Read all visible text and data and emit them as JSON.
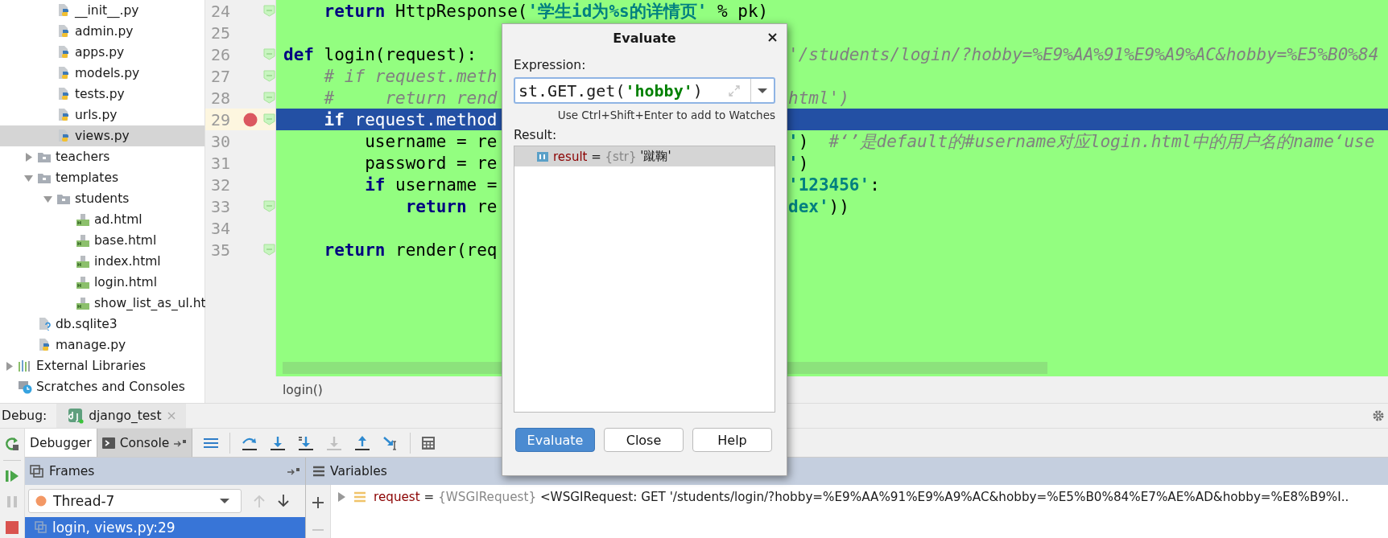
{
  "tree": [
    {
      "children": [
        {
          "children": [
            {
              "label": "__init__.py",
              "kind": "python",
              "selected": false
            },
            {
              "label": "admin.py",
              "kind": "python",
              "selected": false
            },
            {
              "label": "apps.py",
              "kind": "python",
              "selected": false
            },
            {
              "label": "models.py",
              "kind": "python",
              "selected": false
            },
            {
              "label": "tests.py",
              "kind": "python",
              "selected": false
            },
            {
              "label": "urls.py",
              "kind": "python",
              "selected": false
            },
            {
              "label": "views.py",
              "kind": "python",
              "selected": true
            }
          ]
        },
        {
          "label": "teachers",
          "kind": "folder",
          "expanded": false,
          "selected": false
        },
        {
          "label": "templates",
          "kind": "folder",
          "expanded": true,
          "selected": false,
          "children": [
            {
              "label": "students",
              "kind": "folder",
              "expanded": true,
              "selected": false,
              "children": [
                {
                  "label": "ad.html",
                  "kind": "html",
                  "selected": false
                },
                {
                  "label": "base.html",
                  "kind": "html",
                  "selected": false
                },
                {
                  "label": "index.html",
                  "kind": "html",
                  "selected": false
                },
                {
                  "label": "login.html",
                  "kind": "html",
                  "selected": false
                },
                {
                  "label": "show_list_as_ul.ht",
                  "kind": "html",
                  "selected": false
                }
              ]
            }
          ]
        },
        {
          "label": "db.sqlite3",
          "kind": "unknown",
          "selected": false
        },
        {
          "label": "manage.py",
          "kind": "python",
          "selected": false
        }
      ]
    },
    {
      "label": "External Libraries",
      "kind": "libraries",
      "expanded": false,
      "selected": false
    },
    {
      "label": "Scratches and Consoles",
      "kind": "scratches",
      "selected": false
    }
  ],
  "editor": {
    "lines": [
      {
        "number": "24",
        "breakpoint": false,
        "current": false,
        "fold": true,
        "left": [
          {
            "text": "    return",
            "kind": "keyword"
          },
          {
            "text": " HttpResponse(",
            "kind": "plain"
          },
          {
            "text": "'学生id为%s的详情页'",
            "kind": "string"
          },
          {
            "text": " % pk)",
            "kind": "plain"
          }
        ]
      },
      {
        "number": "25",
        "breakpoint": false,
        "current": false,
        "fold": false
      },
      {
        "number": "26",
        "breakpoint": false,
        "current": false,
        "fold": true,
        "left": [
          {
            "text": "def",
            "kind": "keyword"
          },
          {
            "text": " login(request):",
            "kind": "plain"
          }
        ],
        "right": [
          {
            "text": "'/students/login/?hobby=%E9%AA%91%E9%A9%AC&hobby=%E5%B0%84",
            "kind": "comment"
          }
        ]
      },
      {
        "number": "27",
        "breakpoint": false,
        "current": false,
        "fold": true,
        "left": [
          {
            "text": "    # if request.meth",
            "kind": "comment"
          }
        ]
      },
      {
        "number": "28",
        "breakpoint": false,
        "current": false,
        "fold": true,
        "left": [
          {
            "text": "    #     return rend",
            "kind": "comment"
          }
        ],
        "right": [
          {
            "text": "html')",
            "kind": "comment"
          }
        ]
      },
      {
        "number": "29",
        "breakpoint": true,
        "current": true,
        "fold": true,
        "left": [
          {
            "text": "    if",
            "kind": "keyword"
          },
          {
            "text": " request.method",
            "kind": "plain"
          }
        ]
      },
      {
        "number": "30",
        "breakpoint": false,
        "current": false,
        "fold": false,
        "left": [
          {
            "text": "        username = re",
            "kind": "plain"
          }
        ],
        "right": [
          {
            "text": "'",
            "kind": "string"
          },
          {
            "text": ")  ",
            "kind": "plain"
          },
          {
            "text": "#‘’是default的#username对应login.html中的用户名的name‘use",
            "kind": "comment"
          }
        ]
      },
      {
        "number": "31",
        "breakpoint": false,
        "current": false,
        "fold": false,
        "left": [
          {
            "text": "        password = re",
            "kind": "plain"
          }
        ],
        "right": [
          {
            "text": "'",
            "kind": "string"
          },
          {
            "text": ")",
            "kind": "plain"
          }
        ]
      },
      {
        "number": "32",
        "breakpoint": false,
        "current": false,
        "fold": false,
        "left": [
          {
            "text": "        if",
            "kind": "keyword"
          },
          {
            "text": " username =",
            "kind": "plain"
          }
        ],
        "right": [
          {
            "text": "'123456'",
            "kind": "string"
          },
          {
            "text": ":",
            "kind": "plain"
          }
        ]
      },
      {
        "number": "33",
        "breakpoint": false,
        "current": false,
        "fold": true,
        "left": [
          {
            "text": "            return",
            "kind": "keyword"
          },
          {
            "text": " re",
            "kind": "plain"
          }
        ],
        "right": [
          {
            "text": "dex'",
            "kind": "string"
          },
          {
            "text": "))",
            "kind": "plain"
          }
        ]
      },
      {
        "number": "34",
        "breakpoint": false,
        "current": false,
        "fold": false
      },
      {
        "number": "35",
        "breakpoint": false,
        "current": false,
        "fold": true,
        "left": [
          {
            "text": "    return",
            "kind": "keyword"
          },
          {
            "text": " render(req",
            "kind": "plain"
          }
        ]
      }
    ],
    "breadcrumb": "login()"
  },
  "debug": {
    "label": "Debug:",
    "session": "django_test",
    "tabs": [
      {
        "label": "Debugger",
        "selected": true
      },
      {
        "label": "Console",
        "selected": false
      }
    ],
    "toolbar": [
      {
        "kind": "step_over",
        "disabled": false
      },
      {
        "kind": "step_into",
        "disabled": false
      },
      {
        "kind": "step_into_my_code",
        "disabled": false
      },
      {
        "kind": "force_step_into",
        "disabled": true
      },
      {
        "kind": "step_out",
        "disabled": false
      },
      {
        "kind": "run_to_cursor",
        "disabled": false
      }
    ],
    "frames": {
      "title": "Frames",
      "thread": "Thread-7",
      "items": [
        {
          "label": "login, views.py:29",
          "selected": true
        }
      ]
    },
    "variables": {
      "title": "Variables",
      "items": [
        {
          "name": "request",
          "equals": "=",
          "type": "{WSGIRequest}",
          "value": "<WSGIRequest: GET '/students/login/?hobby=%E9%AA%91%E9%A9%AC&hobby=%E5%B0%84%E7%AE%AD&hobby=%E8%B9%I..",
          "expanded": false
        }
      ]
    }
  },
  "dialog": {
    "title": "Evaluate",
    "expression_label": "Expression:",
    "expression": [
      {
        "text": "st.GET.get(",
        "kind": "plain"
      },
      {
        "text": "'hobby'",
        "kind": "string"
      },
      {
        "text": ")",
        "kind": "plain"
      }
    ],
    "hint": "Use Ctrl+Shift+Enter to add to Watches",
    "result_label": "Result:",
    "results": [
      {
        "name": "result",
        "equals": "=",
        "type": "{str}",
        "value": "'蹴鞠'",
        "selected": true
      }
    ],
    "buttons": [
      {
        "label": "Evaluate",
        "primary": true
      },
      {
        "label": "Close",
        "primary": false
      },
      {
        "label": "Help",
        "primary": false
      }
    ]
  }
}
